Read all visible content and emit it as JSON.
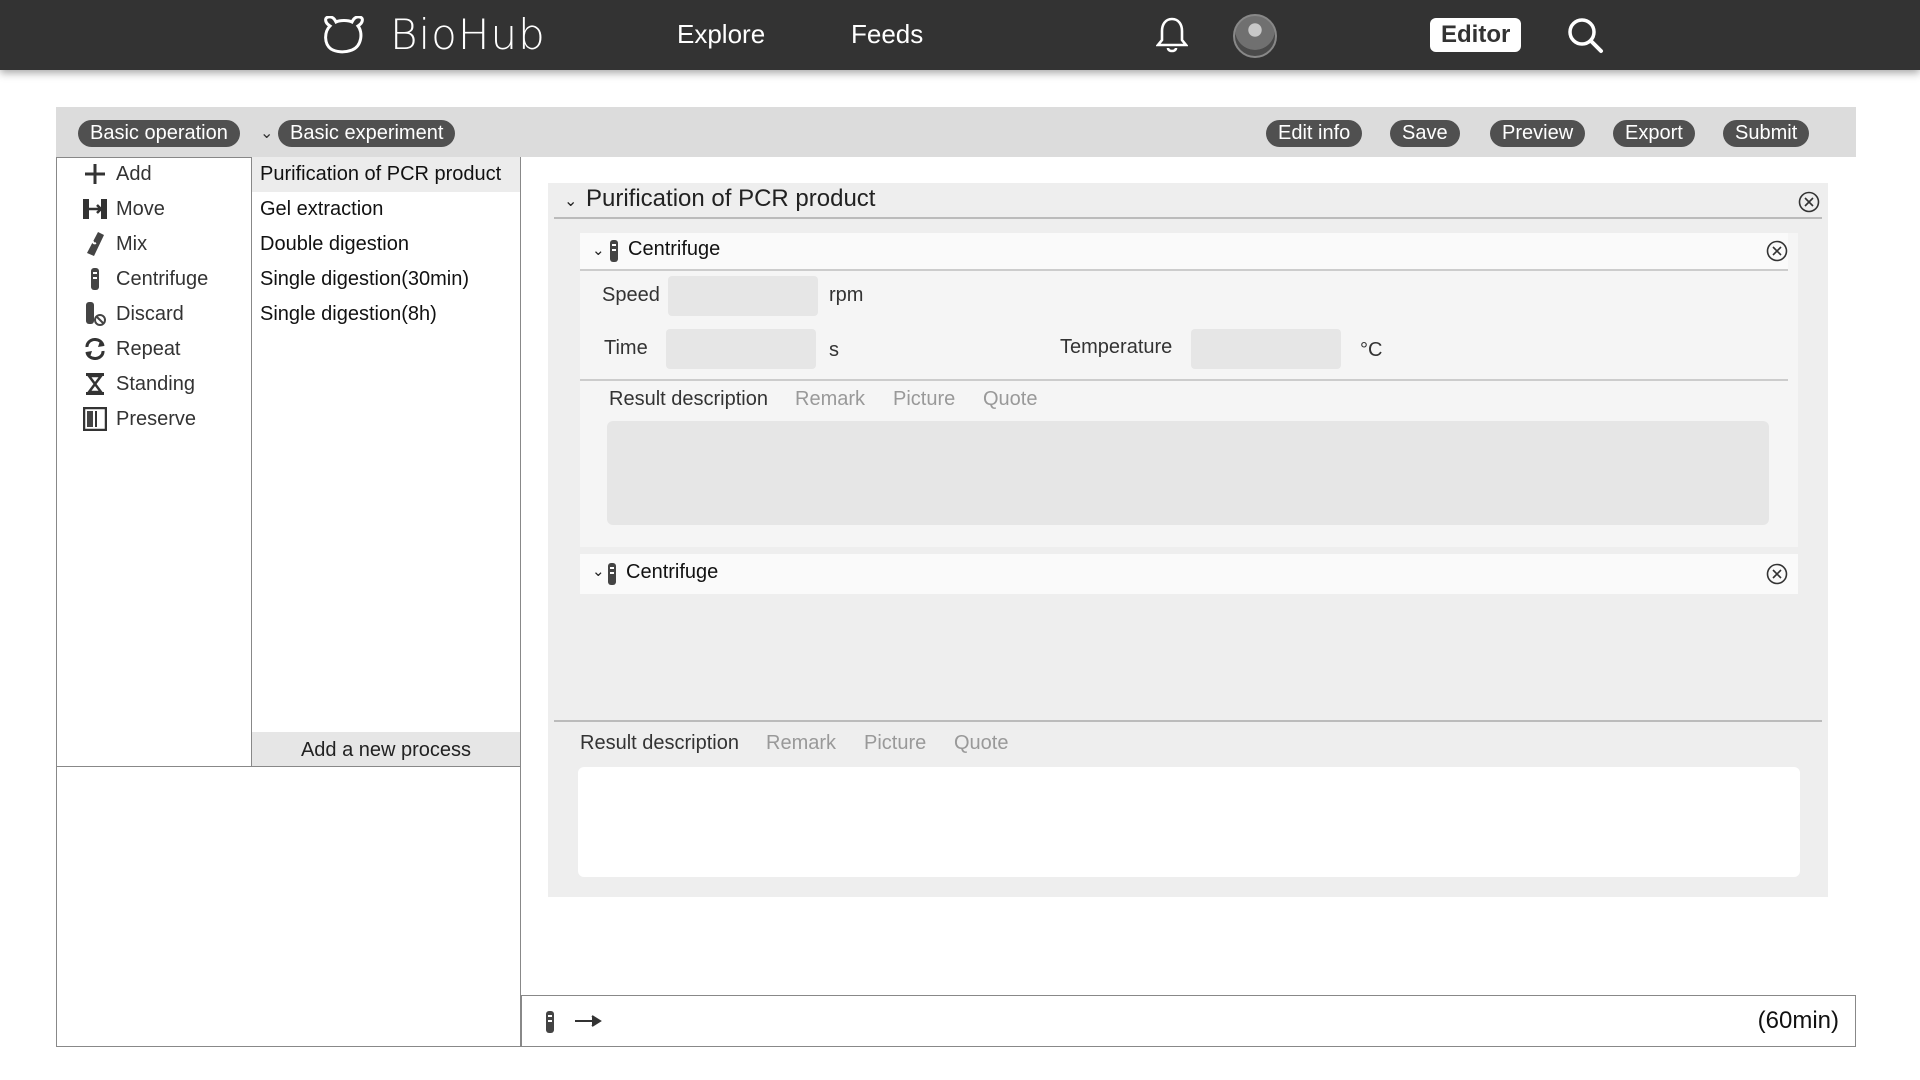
{
  "nav": {
    "brand": "BioHub",
    "explore": "Explore",
    "feeds": "Feeds",
    "editor": "Editor"
  },
  "toolbar": {
    "basic_operation": "Basic operation",
    "basic_experiment": "Basic experiment",
    "edit_info": "Edit info",
    "save": "Save",
    "preview": "Preview",
    "export": "Export",
    "submit": "Submit"
  },
  "operations": [
    {
      "label": "Add",
      "icon": "plus-icon"
    },
    {
      "label": "Move",
      "icon": "move-icon"
    },
    {
      "label": "Mix",
      "icon": "mix-icon"
    },
    {
      "label": "Centrifuge",
      "icon": "centrifuge-tube-icon"
    },
    {
      "label": "Discard",
      "icon": "discard-icon"
    },
    {
      "label": "Repeat",
      "icon": "repeat-icon"
    },
    {
      "label": "Standing",
      "icon": "hourglass-icon"
    },
    {
      "label": "Preserve",
      "icon": "preserve-icon"
    }
  ],
  "experiments": [
    "Purification of PCR product",
    "Gel extraction",
    "Double digestion",
    "Single digestion(30min)",
    "Single digestion(8h)"
  ],
  "add_process": "Add a new process",
  "process": {
    "title": "Purification of PCR product",
    "steps": [
      {
        "name": "Centrifuge",
        "speed_label": "Speed",
        "speed_value": "",
        "speed_unit": "rpm",
        "time_label": "Time",
        "time_value": "",
        "time_unit": "s",
        "temp_label": "Temperature",
        "temp_value": "",
        "temp_unit": "°C",
        "tabs": [
          "Result description",
          "Remark",
          "Picture",
          "Quote"
        ]
      },
      {
        "name": "Centrifuge"
      }
    ],
    "tabs": [
      "Result description",
      "Remark",
      "Picture",
      "Quote"
    ]
  },
  "timeline": {
    "duration": "(60min)"
  }
}
